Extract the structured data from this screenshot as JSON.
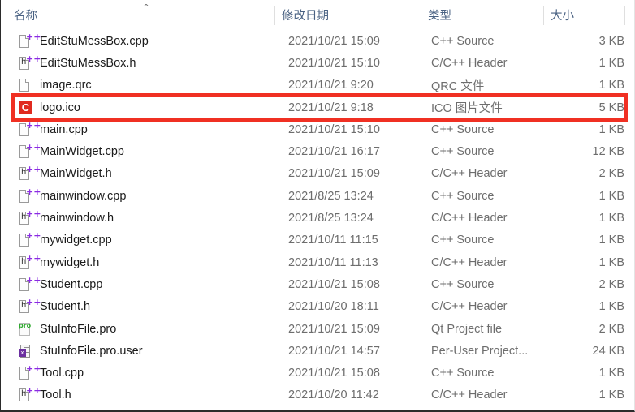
{
  "window": {
    "title": "File Explorer details list",
    "accent_highlight_color": "#f03023",
    "header_text_color": "#4a6283"
  },
  "header": {
    "sort_indicator_icon": "chevron-up-icon",
    "sort_indicator_glyph": "^",
    "columns": [
      {
        "label": "名称"
      },
      {
        "label": "修改日期"
      },
      {
        "label": "类型"
      },
      {
        "label": "大小"
      }
    ]
  },
  "files": [
    {
      "name": "EditStuMessBox.cpp",
      "date": "2021/10/21 15:09",
      "type": "C++ Source",
      "size": "3 KB",
      "icon": "cpp-file-icon",
      "highlighted": false
    },
    {
      "name": "EditStuMessBox.h",
      "date": "2021/10/21 15:10",
      "type": "C/C++ Header",
      "size": "1 KB",
      "icon": "header-file-icon",
      "highlighted": false
    },
    {
      "name": "image.qrc",
      "date": "2021/10/21 9:20",
      "type": "QRC 文件",
      "size": "1 KB",
      "icon": "blank-file-icon",
      "highlighted": false
    },
    {
      "name": "logo.ico",
      "date": "2021/10/21 9:18",
      "type": "ICO 图片文件",
      "size": "5 KB",
      "icon": "ico-image-icon",
      "highlighted": true
    },
    {
      "name": "main.cpp",
      "date": "2021/10/21 15:10",
      "type": "C++ Source",
      "size": "1 KB",
      "icon": "cpp-file-icon",
      "highlighted": false
    },
    {
      "name": "MainWidget.cpp",
      "date": "2021/10/21 16:17",
      "type": "C++ Source",
      "size": "12 KB",
      "icon": "cpp-file-icon",
      "highlighted": false
    },
    {
      "name": "MainWidget.h",
      "date": "2021/10/21 15:09",
      "type": "C/C++ Header",
      "size": "2 KB",
      "icon": "header-file-icon",
      "highlighted": false
    },
    {
      "name": "mainwindow.cpp",
      "date": "2021/8/25 13:24",
      "type": "C++ Source",
      "size": "1 KB",
      "icon": "cpp-file-icon",
      "highlighted": false
    },
    {
      "name": "mainwindow.h",
      "date": "2021/8/25 13:24",
      "type": "C/C++ Header",
      "size": "1 KB",
      "icon": "header-file-icon",
      "highlighted": false
    },
    {
      "name": "mywidget.cpp",
      "date": "2021/10/11 11:15",
      "type": "C++ Source",
      "size": "1 KB",
      "icon": "cpp-file-icon",
      "highlighted": false
    },
    {
      "name": "mywidget.h",
      "date": "2021/10/11 11:13",
      "type": "C/C++ Header",
      "size": "1 KB",
      "icon": "header-file-icon",
      "highlighted": false
    },
    {
      "name": "Student.cpp",
      "date": "2021/10/21 15:08",
      "type": "C++ Source",
      "size": "2 KB",
      "icon": "cpp-file-icon",
      "highlighted": false
    },
    {
      "name": "Student.h",
      "date": "2021/10/20 18:11",
      "type": "C/C++ Header",
      "size": "1 KB",
      "icon": "header-file-icon",
      "highlighted": false
    },
    {
      "name": "StuInfoFile.pro",
      "date": "2021/10/21 15:09",
      "type": "Qt Project file",
      "size": "2 KB",
      "icon": "qt-project-icon",
      "highlighted": false
    },
    {
      "name": "StuInfoFile.pro.user",
      "date": "2021/10/21 14:57",
      "type": "Per-User Project...",
      "size": "24 KB",
      "icon": "per-user-project-icon",
      "highlighted": false
    },
    {
      "name": "Tool.cpp",
      "date": "2021/10/21 15:08",
      "type": "C++ Source",
      "size": "1 KB",
      "icon": "cpp-file-icon",
      "highlighted": false
    },
    {
      "name": "Tool.h",
      "date": "2021/10/20 11:42",
      "type": "C/C++ Header",
      "size": "1 KB",
      "icon": "header-file-icon",
      "highlighted": false
    }
  ],
  "icon_glyphs": {
    "cpp_marks": "++",
    "header_letter": "h",
    "ico_letter": "C",
    "pro_text": "pro",
    "user_badge": "x"
  }
}
